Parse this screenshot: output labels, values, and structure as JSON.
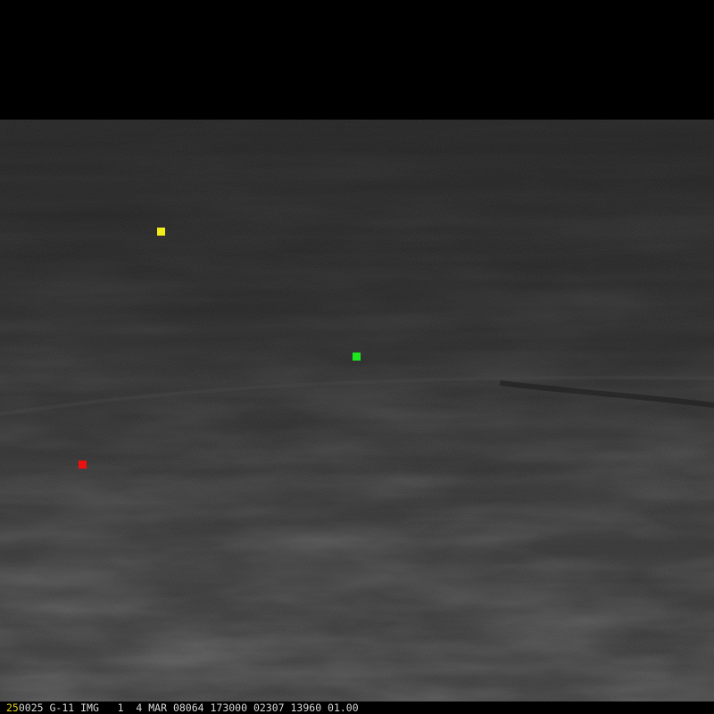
{
  "colors": {
    "space": "#000000",
    "status_text": "#d8d8d8",
    "frame_number_text": "#e6d21e"
  },
  "markers": [
    {
      "name": "yellow-marker",
      "color": "#f2ec18"
    },
    {
      "name": "green-marker",
      "color": "#1ee61e"
    },
    {
      "name": "red-marker",
      "color": "#ec1010"
    }
  ],
  "status_bar": {
    "frame_number": "25",
    "label": "0025 G-11 IMG   1  4 MAR 08064 173000 02307 13960 01.00"
  }
}
